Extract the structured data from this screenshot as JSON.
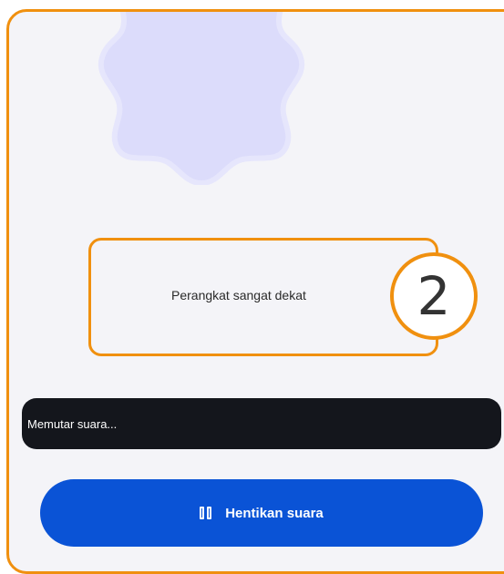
{
  "callout": {
    "text": "Perangkat sangat dekat",
    "badge_number": "2"
  },
  "status": {
    "text": "Memutar suara..."
  },
  "actions": {
    "stop_label": "Hentikan suara",
    "stop_icon": "pause-icon"
  },
  "colors": {
    "accent_orange": "#f0900f",
    "background": "#f4f4f8",
    "blob_fill": "#dcdcfb",
    "status_bg": "#14161c",
    "primary_blue": "#0a53d6"
  }
}
